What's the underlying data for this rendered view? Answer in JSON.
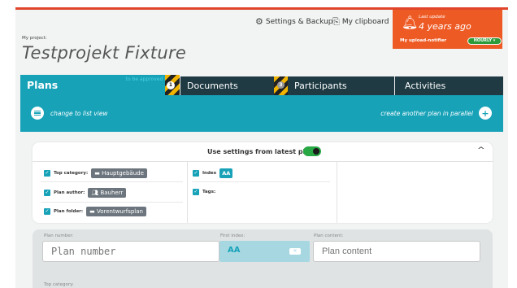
{
  "header": {
    "settings_label": "Settings & Backup",
    "clipboard_label": "My clipboard"
  },
  "notifier": {
    "last_update_label": "Last update",
    "age": "4 years ago",
    "name": "My upload-notifier",
    "frequency": "HOURLY ▾",
    "color": "#ee5a24"
  },
  "project": {
    "label": "My project:",
    "title": "Testprojekt Fixture"
  },
  "tabs": [
    {
      "label": "Plans",
      "sub": "to be approved by me",
      "badge": "1"
    },
    {
      "label": "Documents",
      "badge": "3"
    },
    {
      "label": "Participants"
    },
    {
      "label": "Activities"
    }
  ],
  "toolbar": {
    "list_view": "change to list view",
    "parallel": "create another plan in parallel"
  },
  "settings_card": {
    "title": "Use settings from latest plan",
    "top_category_label": "Top category:",
    "top_category_value": "Hauptgebäude",
    "plan_author_label": "Plan author:",
    "plan_author_value": "Bauherr",
    "plan_folder_label": "Plan folder:",
    "plan_folder_value": "Vorentwurfsplan",
    "index_label": "Index",
    "index_value": "AA",
    "tags_label": "Tags:"
  },
  "form": {
    "plan_number_label": "Plan number:",
    "plan_number_placeholder": "Plan number",
    "first_index_label": "First index:",
    "first_index_value": "AA",
    "plan_content_label": "Plan content:",
    "plan_content_placeholder": "Plan content",
    "top_category_label": "Top category:"
  },
  "colors": {
    "accent": "#17a2b8",
    "dark_tab": "#1f3a43",
    "toggle_on": "#28a745"
  }
}
